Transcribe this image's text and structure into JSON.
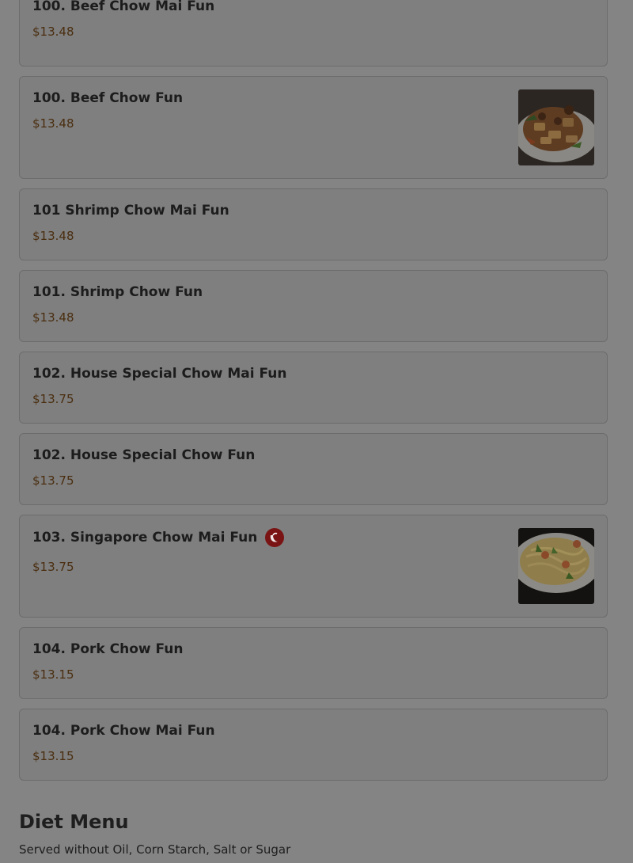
{
  "items": [
    {
      "name": "100. Beef Chow Mai Fun",
      "price": "$13.48"
    },
    {
      "name": "100. Beef Chow Fun",
      "price": "$13.48",
      "image": "beef-chow-fun-photo"
    },
    {
      "name": "101 Shrimp Chow Mai Fun",
      "price": "$13.48"
    },
    {
      "name": "101. Shrimp Chow Fun",
      "price": "$13.48"
    },
    {
      "name": "102. House Special Chow Mai Fun",
      "price": "$13.75"
    },
    {
      "name": "102. House Special Chow Fun",
      "price": "$13.75"
    },
    {
      "name": "103. Singapore Chow Mai Fun",
      "price": "$13.75",
      "icon": "spicy-pepper-icon",
      "image": "singapore-chow-mai-fun-photo"
    },
    {
      "name": "104. Pork Chow Fun",
      "price": "$13.15"
    },
    {
      "name": "104. Pork Chow Mai Fun",
      "price": "$13.15"
    }
  ],
  "section": {
    "title": "Diet Menu",
    "description": "Served without Oil, Corn Starch, Salt or Sugar"
  },
  "colors": {
    "overlay": "#848484",
    "price": "#4a2e10",
    "spicy": "#7a1414"
  }
}
